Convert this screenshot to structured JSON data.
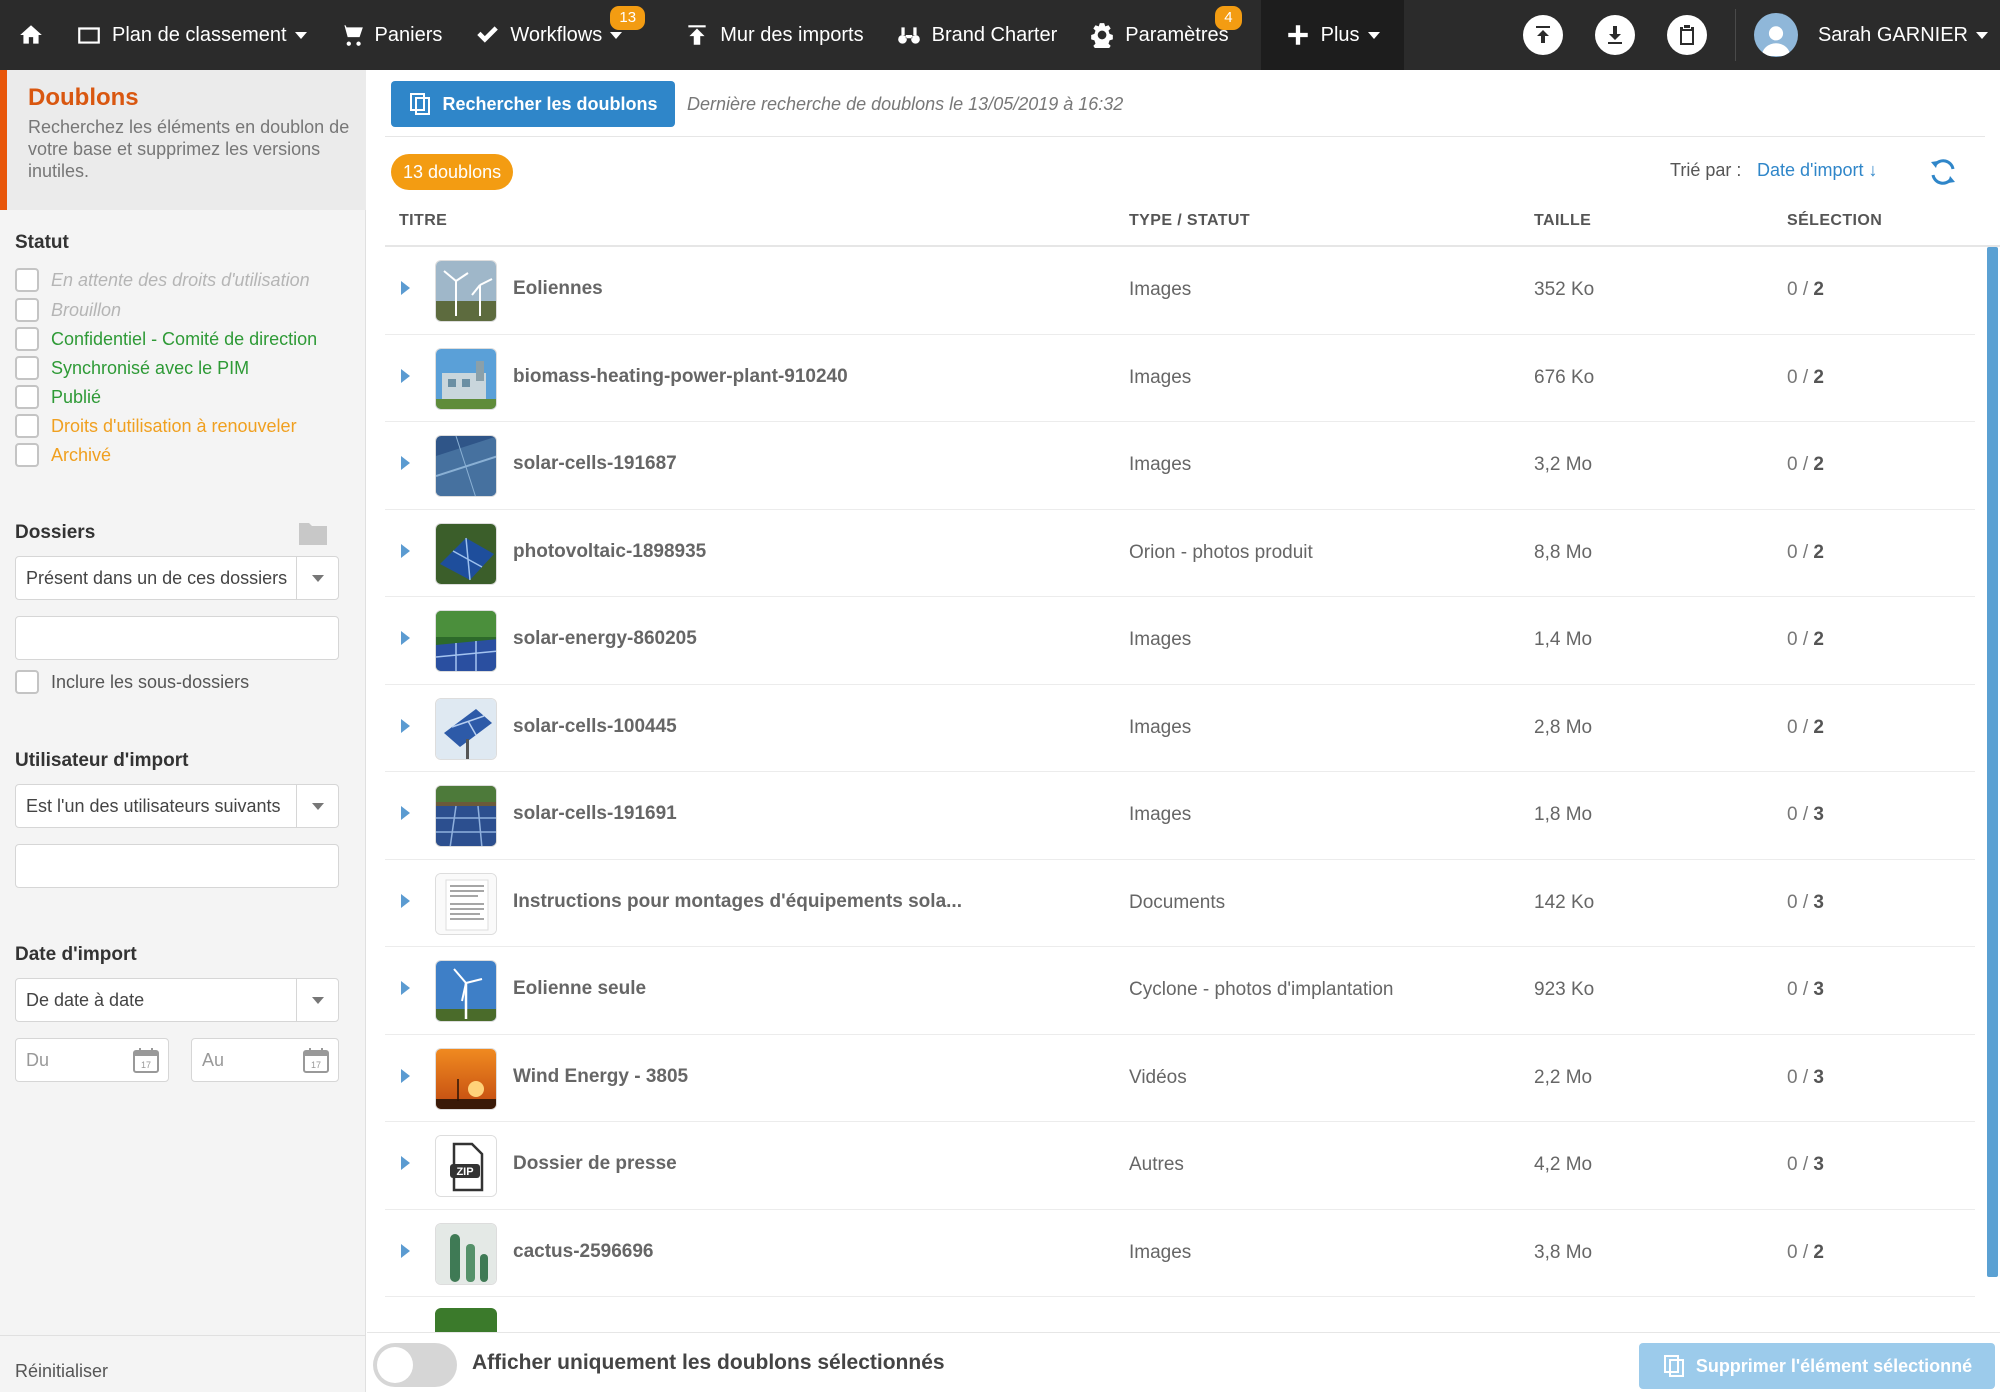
{
  "topnav": {
    "items": [
      {
        "label": "Plan de classement",
        "caret": true,
        "icon": "folder-icon"
      },
      {
        "label": "Paniers",
        "caret": false,
        "icon": "cart-icon"
      },
      {
        "label": "Workflows",
        "caret": true,
        "icon": "check-icon",
        "badge": "13"
      },
      {
        "label": "Mur des imports",
        "caret": false,
        "icon": "upload-icon"
      },
      {
        "label": "Brand Charter",
        "caret": false,
        "icon": "binoculars-icon"
      },
      {
        "label": "Paramètres",
        "caret": false,
        "icon": "gear-icon",
        "badge": "4"
      }
    ],
    "plus_label": "Plus",
    "user_name": "Sarah GARNIER",
    "accent_color": "#f39c12"
  },
  "sidebar": {
    "title": "Doublons",
    "description": "Recherchez les éléments en doublon de votre base et supprimez les versions inutiles.",
    "status_label": "Statut",
    "statuses": [
      {
        "label": "En attente des droits d'utilisation",
        "color": "#b5b5b5",
        "italic": true
      },
      {
        "label": "Brouillon",
        "color": "#b5b5b5",
        "italic": true
      },
      {
        "label": "Confidentiel - Comité de direction",
        "color": "#2e9a36",
        "italic": false
      },
      {
        "label": "Synchronisé avec le PIM",
        "color": "#2e9a36",
        "italic": false
      },
      {
        "label": "Publié",
        "color": "#2e9a36",
        "italic": false
      },
      {
        "label": "Droits d'utilisation à renouveler",
        "color": "#f0a020",
        "italic": false
      },
      {
        "label": "Archivé",
        "color": "#f0a020",
        "italic": false
      }
    ],
    "folders_label": "Dossiers",
    "folders_select": "Présent dans un de ces dossiers",
    "include_subfolders": "Inclure les sous-dossiers",
    "import_user_label": "Utilisateur d'import",
    "import_user_select": "Est l'un des utilisateurs suivants",
    "import_date_label": "Date d'import",
    "import_date_select": "De date à date",
    "date_from_placeholder": "Du",
    "date_to_placeholder": "Au",
    "calendar_day": "17",
    "reset_label": "Réinitialiser"
  },
  "main": {
    "search_button": "Rechercher les doublons",
    "last_search": "Dernière recherche de doublons le 13/05/2019 à 16:32",
    "count_badge": "13 doublons",
    "sort_label": "Trié par :",
    "sort_value": "Date d'import ↓",
    "columns": {
      "title": "TITRE",
      "type": "TYPE / STATUT",
      "size": "TAILLE",
      "selection": "SÉLECTION"
    },
    "rows": [
      {
        "title": "Eoliennes",
        "type": "Images",
        "size": "352 Ko",
        "sel_a": "0 / ",
        "sel_b": "2",
        "thumb": "wind"
      },
      {
        "title": "biomass-heating-power-plant-910240",
        "type": "Images",
        "size": "676 Ko",
        "sel_a": "0 / ",
        "sel_b": "2",
        "thumb": "plant"
      },
      {
        "title": "solar-cells-191687",
        "type": "Images",
        "size": "3,2 Mo",
        "sel_a": "0 / ",
        "sel_b": "2",
        "thumb": "solar"
      },
      {
        "title": "photovoltaic-1898935",
        "type": "Orion - photos produit",
        "size": "8,8 Mo",
        "sel_a": "0 / ",
        "sel_b": "2",
        "thumb": "solar2"
      },
      {
        "title": "solar-energy-860205",
        "type": "Images",
        "size": "1,4 Mo",
        "sel_a": "0 / ",
        "sel_b": "2",
        "thumb": "solar3"
      },
      {
        "title": "solar-cells-100445",
        "type": "Images",
        "size": "2,8 Mo",
        "sel_a": "0 / ",
        "sel_b": "2",
        "thumb": "panel"
      },
      {
        "title": "solar-cells-191691",
        "type": "Images",
        "size": "1,8 Mo",
        "sel_a": "0 / ",
        "sel_b": "3",
        "thumb": "field"
      },
      {
        "title": "Instructions pour montages d'équipements sola...",
        "type": "Documents",
        "size": "142 Ko",
        "sel_a": "0 / ",
        "sel_b": "3",
        "thumb": "doc"
      },
      {
        "title": "Eolienne seule",
        "type": "Cyclone - photos d'implantation",
        "size": "923 Ko",
        "sel_a": "0 / ",
        "sel_b": "3",
        "thumb": "wind2"
      },
      {
        "title": "Wind Energy - 3805",
        "type": "Vidéos",
        "size": "2,2 Mo",
        "sel_a": "0 / ",
        "sel_b": "3",
        "thumb": "sunset"
      },
      {
        "title": "Dossier de presse",
        "type": "Autres",
        "size": "4,2 Mo",
        "sel_a": "0 / ",
        "sel_b": "3",
        "thumb": "zip"
      },
      {
        "title": "cactus-2596696",
        "type": "Images",
        "size": "3,8 Mo",
        "sel_a": "0 / ",
        "sel_b": "2",
        "thumb": "cactus"
      }
    ],
    "toggle_label": "Afficher uniquement les doublons sélectionnés",
    "toggle_on": false,
    "delete_button": "Supprimer l'élément sélectionné",
    "primary_color": "#2f86c9"
  }
}
